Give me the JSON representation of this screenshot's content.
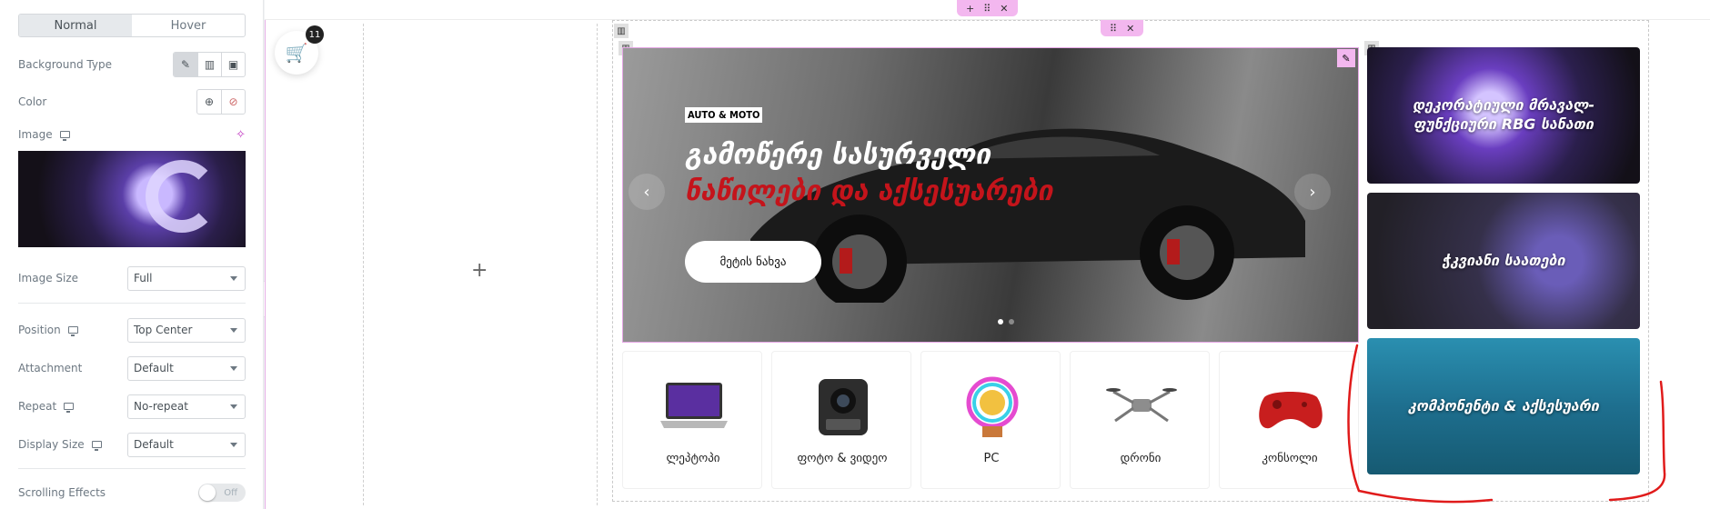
{
  "panel": {
    "tabs": [
      "Normal",
      "Hover"
    ],
    "background_type_label": "Background Type",
    "color_label": "Color",
    "image_label": "Image",
    "image_size_label": "Image Size",
    "image_size_value": "Full",
    "position_label": "Position",
    "position_value": "Top Center",
    "attachment_label": "Attachment",
    "attachment_value": "Default",
    "repeat_label": "Repeat",
    "repeat_value": "No-repeat",
    "display_size_label": "Display Size",
    "display_size_value": "Default",
    "scrolling_label": "Scrolling Effects",
    "scrolling_toggle": "Off"
  },
  "cart": {
    "count": "11"
  },
  "slider": {
    "tag": "AUTO & MOTO",
    "headline": "გამოწერე სასურველი",
    "subheadline": "ნაწილები და აქსესუარები",
    "button": "მეტის ნახვა"
  },
  "categories": [
    {
      "name": "ლეპტოპი"
    },
    {
      "name": "ფოტო & ვიდეო"
    },
    {
      "name": "PC"
    },
    {
      "name": "დრონი"
    },
    {
      "name": "კონსოლი"
    }
  ],
  "promos": [
    {
      "text": "დეკორატიული მრავალ-ფუნქციური RBG სანათი"
    },
    {
      "text": "ჭკვიანი საათები"
    },
    {
      "text": "კომპონენტი & აქსესუარი"
    }
  ],
  "colors": {
    "accent": "#f3b7ef",
    "brand": "#2b46c7",
    "headline_red": "#c4141b"
  }
}
